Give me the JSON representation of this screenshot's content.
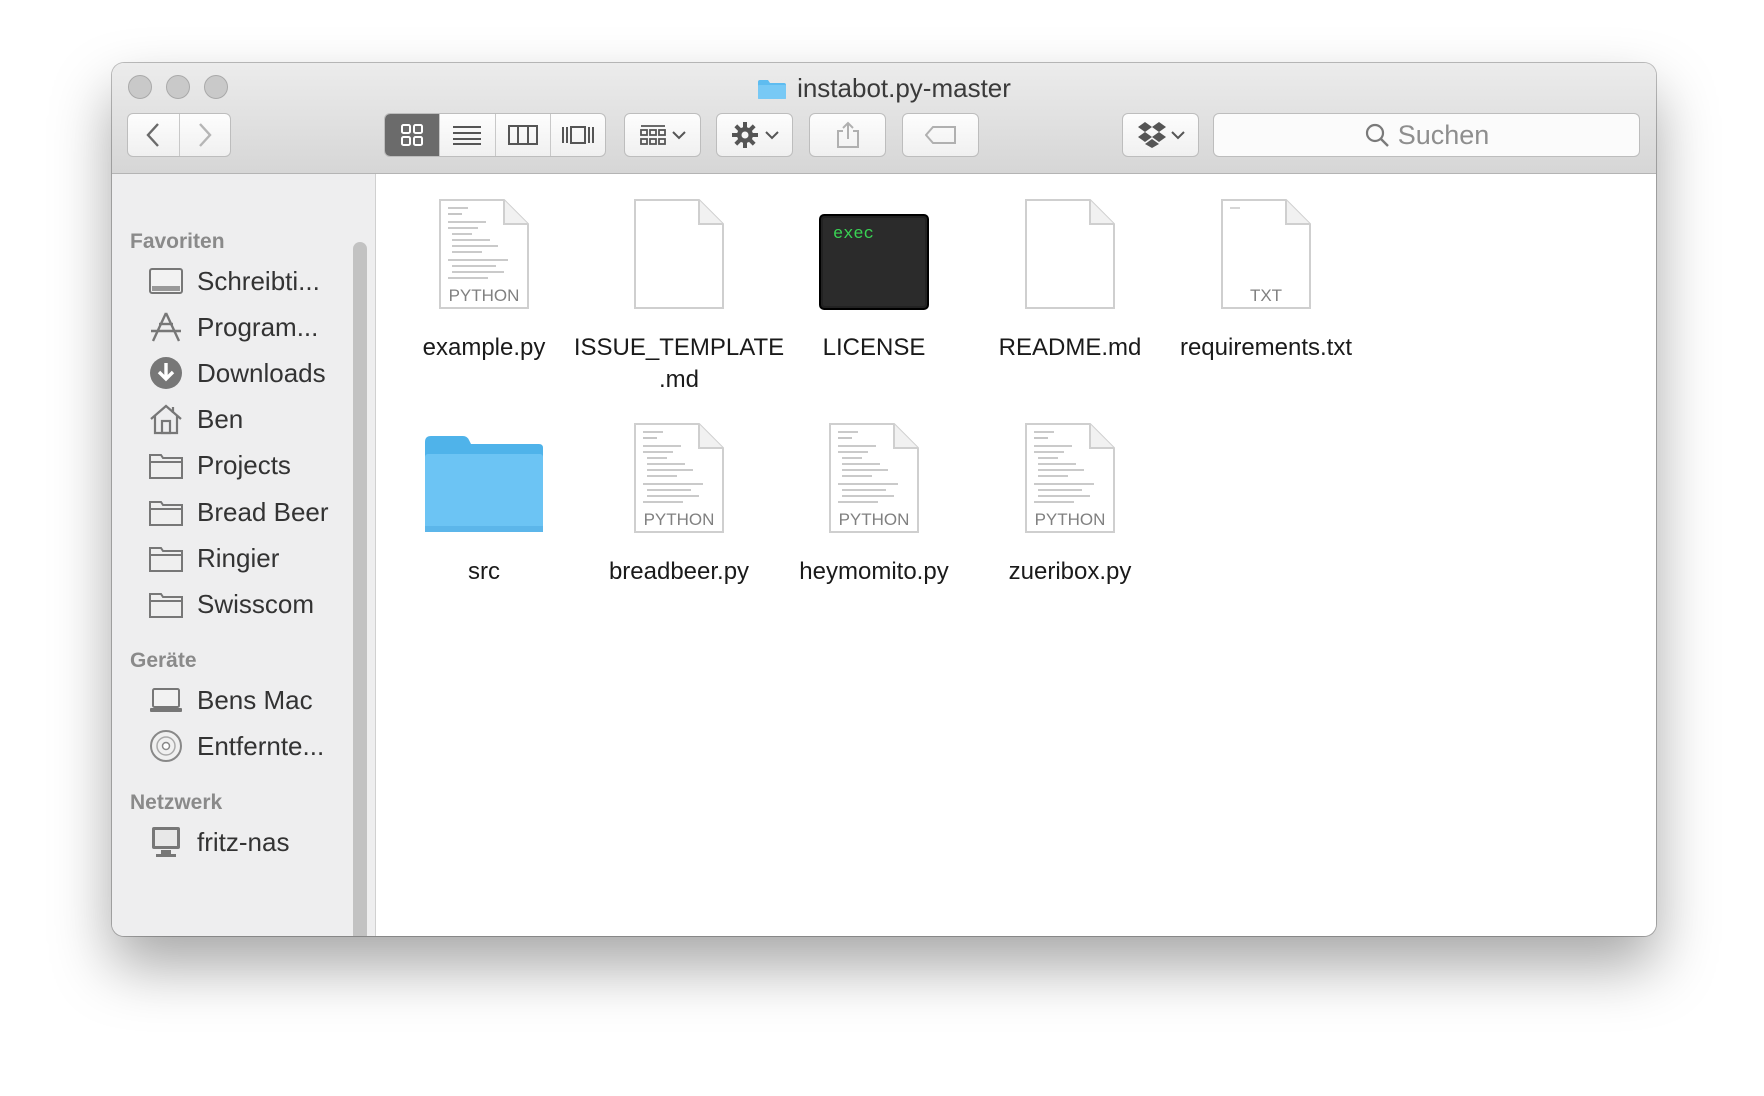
{
  "window": {
    "title": "instabot.py-master"
  },
  "toolbar": {
    "search_placeholder": "Suchen"
  },
  "sidebar": {
    "sections": [
      {
        "label": "Favoriten",
        "items": [
          {
            "label": "Schreibti...",
            "icon": "desktop-icon"
          },
          {
            "label": "Program...",
            "icon": "applications-icon"
          },
          {
            "label": "Downloads",
            "icon": "downloads-icon"
          },
          {
            "label": "Ben",
            "icon": "home-icon"
          },
          {
            "label": "Projects",
            "icon": "folder-icon"
          },
          {
            "label": "Bread Beer",
            "icon": "folder-icon"
          },
          {
            "label": "Ringier",
            "icon": "folder-icon"
          },
          {
            "label": "Swisscom",
            "icon": "folder-icon"
          }
        ]
      },
      {
        "label": "Geräte",
        "items": [
          {
            "label": "Bens Mac",
            "icon": "laptop-icon"
          },
          {
            "label": "Entfernte...",
            "icon": "disc-icon"
          }
        ]
      },
      {
        "label": "Netzwerk",
        "items": [
          {
            "label": "fritz-nas",
            "icon": "network-computer-icon"
          }
        ]
      }
    ]
  },
  "files": [
    {
      "name": "example.py",
      "kind": "python",
      "badge": "PYTHON"
    },
    {
      "name": "ISSUE_TEMPLATE.md",
      "kind": "blank",
      "badge": ""
    },
    {
      "name": "LICENSE",
      "kind": "exec",
      "badge": "exec"
    },
    {
      "name": "README.md",
      "kind": "blank",
      "badge": ""
    },
    {
      "name": "requirements.txt",
      "kind": "txt",
      "badge": "TXT"
    },
    {
      "name": "src",
      "kind": "folder",
      "badge": ""
    },
    {
      "name": "breadbeer.py",
      "kind": "python",
      "badge": "PYTHON"
    },
    {
      "name": "heymomito.py",
      "kind": "python",
      "badge": "PYTHON"
    },
    {
      "name": "zueribox.py",
      "kind": "python",
      "badge": "PYTHON"
    }
  ]
}
